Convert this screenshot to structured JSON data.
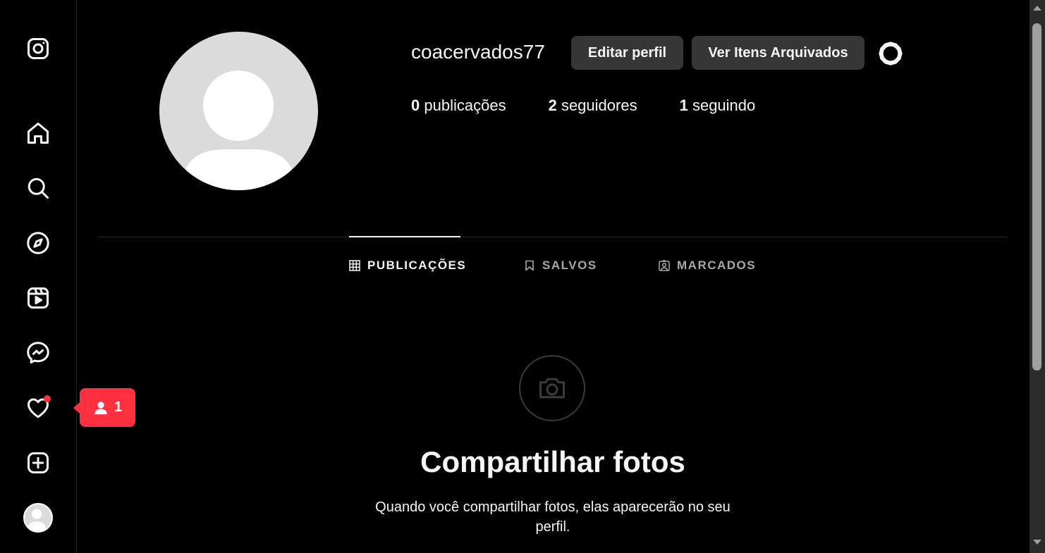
{
  "profile": {
    "username": "coacervados77",
    "edit_button": "Editar perfil",
    "archive_button": "Ver Itens Arquivados",
    "stats": {
      "posts_count": "0",
      "posts_label": "publicações",
      "followers_count": "2",
      "followers_label": "seguidores",
      "following_count": "1",
      "following_label": "seguindo"
    }
  },
  "tabs": [
    {
      "label": "PUBLICAÇÕES",
      "icon": "grid-icon",
      "active": true
    },
    {
      "label": "SALVOS",
      "icon": "bookmark-icon",
      "active": false
    },
    {
      "label": "MARCADOS",
      "icon": "tagged-user-icon",
      "active": false
    }
  ],
  "empty_state": {
    "icon": "camera-icon",
    "title": "Compartilhar fotos",
    "text": "Quando você compartilhar fotos, elas aparecerão no seu perfil."
  },
  "sidebar": {
    "items": [
      {
        "icon": "instagram-logo-icon"
      },
      {
        "icon": "home-icon"
      },
      {
        "icon": "search-icon"
      },
      {
        "icon": "explore-compass-icon"
      },
      {
        "icon": "reels-icon"
      },
      {
        "icon": "messenger-icon"
      },
      {
        "icon": "heart-notifications-icon"
      },
      {
        "icon": "create-plus-icon"
      },
      {
        "icon": "profile-avatar"
      }
    ],
    "notification_badge": {
      "icon": "user-icon",
      "count": "1"
    }
  },
  "colors": {
    "background": "#000000",
    "text": "#f5f5f5",
    "button_bg": "#363636",
    "notification_red": "#ff3040",
    "muted_text": "#a8a8a8"
  }
}
